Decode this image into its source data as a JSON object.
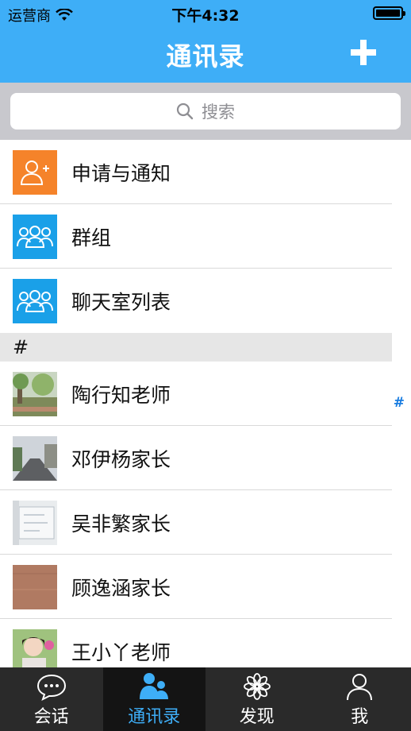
{
  "status_bar": {
    "carrier": "运营商",
    "time": "下午4:32"
  },
  "nav": {
    "title": "通讯录"
  },
  "search": {
    "placeholder": "搜索"
  },
  "menu_items": [
    {
      "label": "申请与通知",
      "icon": "add-user-icon",
      "color": "#f5832a"
    },
    {
      "label": "群组",
      "icon": "group-icon",
      "color": "#1aa0e8"
    },
    {
      "label": "聊天室列表",
      "icon": "group-icon",
      "color": "#1aa0e8"
    }
  ],
  "section_header": "#",
  "contacts": [
    {
      "name": "陶行知老师"
    },
    {
      "name": "邓伊杨家长"
    },
    {
      "name": "吴非繁家长"
    },
    {
      "name": "顾逸涵家长"
    },
    {
      "name": "王小丫老师"
    }
  ],
  "index_bar": [
    "#"
  ],
  "tabs": [
    {
      "label": "会话",
      "icon": "chat-bubble-icon",
      "active": false
    },
    {
      "label": "通讯录",
      "icon": "contacts-icon",
      "active": true
    },
    {
      "label": "发现",
      "icon": "flower-icon",
      "active": false
    },
    {
      "label": "我",
      "icon": "person-icon",
      "active": false
    }
  ],
  "colors": {
    "nav_bg": "#3eaef7",
    "tab_bg": "#2a2a2a",
    "tab_active": "#3eaef7",
    "index_color": "#1a7de0"
  }
}
